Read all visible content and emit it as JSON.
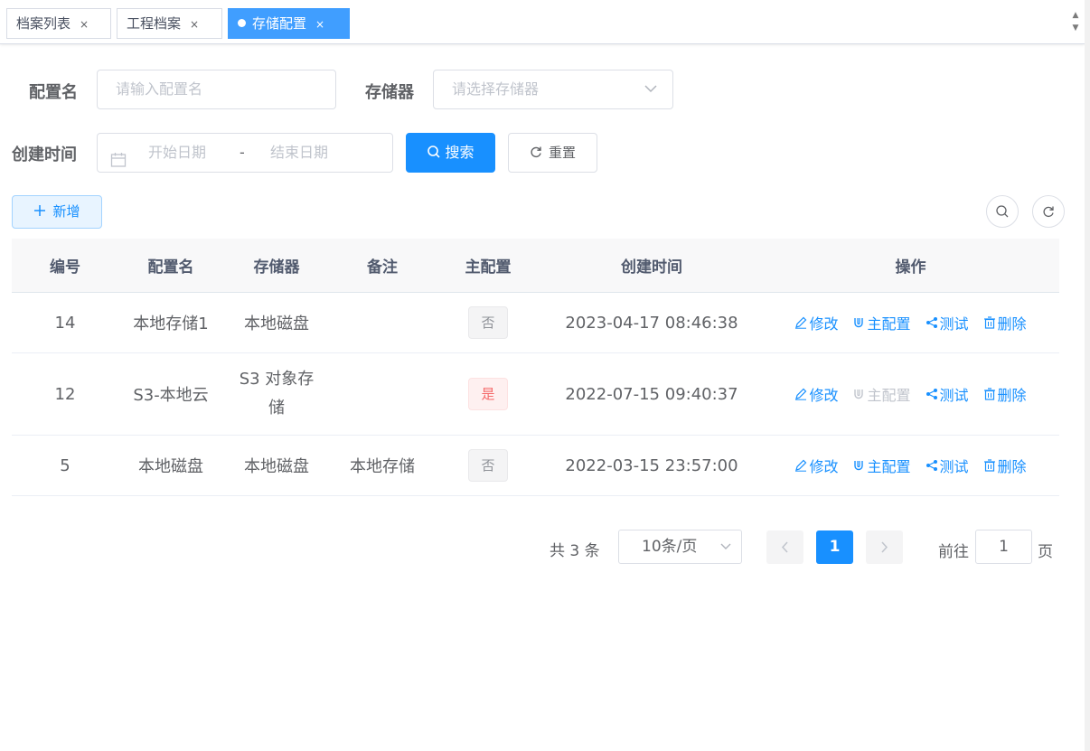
{
  "tabs": [
    {
      "label": "档案列表",
      "close": "×"
    },
    {
      "label": "工程档案",
      "close": "×"
    },
    {
      "label": "存储配置",
      "close": "×"
    }
  ],
  "scroll_arrows": {
    "up": "▲",
    "down": "▼"
  },
  "form": {
    "config_name_label": "配置名",
    "config_name_placeholder": "请输入配置名",
    "storage_label": "存储器",
    "storage_placeholder": "请选择存储器",
    "created_label": "创建时间",
    "start_placeholder": "开始日期",
    "range_separator": "-",
    "end_placeholder": "结束日期",
    "search_label": "搜索",
    "reset_label": "重置"
  },
  "toolbar": {
    "add_label": "新增"
  },
  "table": {
    "headers": [
      "编号",
      "配置名",
      "存储器",
      "备注",
      "主配置",
      "创建时间",
      "操作"
    ],
    "rows": [
      {
        "id": "14",
        "name": "本地存储1",
        "storage": "本地磁盘",
        "remark": "",
        "master": "否",
        "is_master": false,
        "created": "2023-04-17 08:46:38"
      },
      {
        "id": "12",
        "name": "S3-本地云",
        "storage": "S3 对象存储",
        "remark": "",
        "master": "是",
        "is_master": true,
        "created": "2022-07-15 09:40:37"
      },
      {
        "id": "5",
        "name": "本地磁盘",
        "storage": "本地磁盘",
        "remark": "本地存储",
        "master": "否",
        "is_master": false,
        "created": "2022-03-15 23:57:00"
      }
    ],
    "actions": {
      "edit": "修改",
      "master": "主配置",
      "test": "测试",
      "delete": "删除"
    }
  },
  "pagination": {
    "total": "共 3 条",
    "page_size": "10条/页",
    "current_page": "1",
    "goto_label": "前往",
    "goto_value": "1",
    "page_unit": "页"
  },
  "colors": {
    "primary": "#1890ff",
    "danger": "#f56c6c",
    "muted": "#909399"
  }
}
